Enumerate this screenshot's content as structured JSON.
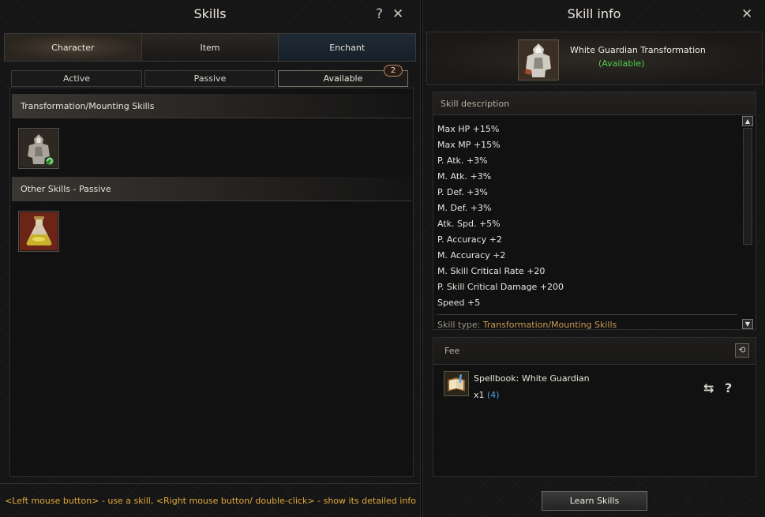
{
  "skills_window": {
    "title": "Skills",
    "help_icon": "?",
    "close_icon": "✕",
    "main_tabs": [
      {
        "label": "Character"
      },
      {
        "label": "Item"
      },
      {
        "label": "Enchant"
      }
    ],
    "sub_tabs": [
      {
        "label": "Active"
      },
      {
        "label": "Passive"
      },
      {
        "label": "Available",
        "badge": "2"
      }
    ],
    "sections": [
      {
        "title": "Transformation/Mounting Skills",
        "icon": "white-guardian-armor-icon"
      },
      {
        "title": "Other Skills - Passive",
        "icon": "potion-flask-icon"
      }
    ],
    "status_text": "<Left mouse button> - use a skill, <Right mouse button/ double-click> - show its detailed info"
  },
  "info_window": {
    "title": "Skill info",
    "close_icon": "✕",
    "skill_name": "White Guardian Transformation",
    "skill_status": "(Available)",
    "description_label": "Skill description",
    "description_lines": [
      "Max HP +15%",
      "Max MP +15%",
      "P. Atk. +3%",
      "M. Atk. +3%",
      "P. Def. +3%",
      "M. Def. +3%",
      "Atk. Spd. +5%",
      "P. Accuracy +2",
      "M. Accuracy +2",
      "M. Skill Critical Rate +20",
      "P. Skill Critical Damage +200",
      "Speed +5"
    ],
    "skill_type_label": "Skill type:",
    "skill_type_value": "Transformation/Mounting Skills",
    "fee_label": "Fee",
    "fee_item_name": "Spellbook: White Guardian",
    "fee_item_qty": "x1",
    "fee_item_owned": "(4)",
    "learn_button": "Learn Skills"
  },
  "colors": {
    "accent_gold": "#e0a83a",
    "available_green": "#4fd04f",
    "owned_blue": "#4aa3e6",
    "skill_type_orange": "#c99a55"
  }
}
